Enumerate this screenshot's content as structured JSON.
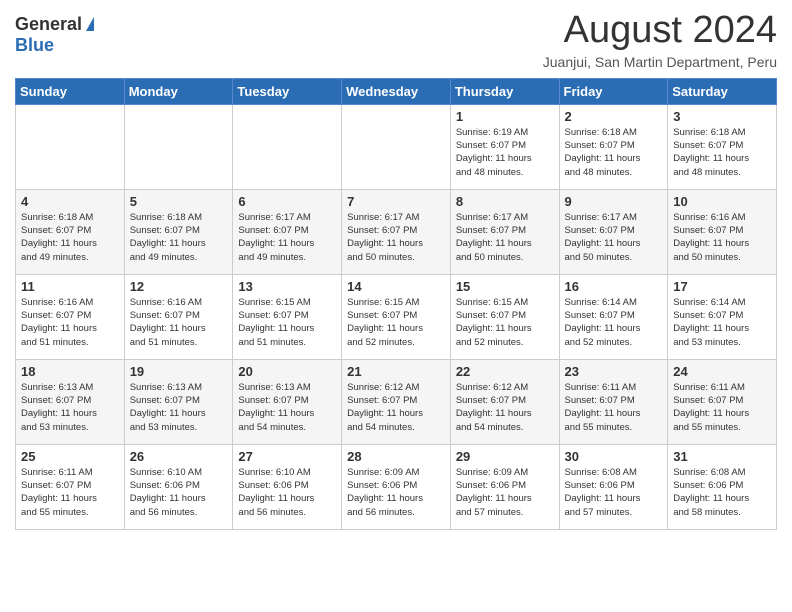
{
  "header": {
    "logo_general": "General",
    "logo_blue": "Blue",
    "month_title": "August 2024",
    "location": "Juanjui, San Martin Department, Peru"
  },
  "weekdays": [
    "Sunday",
    "Monday",
    "Tuesday",
    "Wednesday",
    "Thursday",
    "Friday",
    "Saturday"
  ],
  "weeks": [
    [
      {
        "day": "",
        "info": ""
      },
      {
        "day": "",
        "info": ""
      },
      {
        "day": "",
        "info": ""
      },
      {
        "day": "",
        "info": ""
      },
      {
        "day": "1",
        "info": "Sunrise: 6:19 AM\nSunset: 6:07 PM\nDaylight: 11 hours\nand 48 minutes."
      },
      {
        "day": "2",
        "info": "Sunrise: 6:18 AM\nSunset: 6:07 PM\nDaylight: 11 hours\nand 48 minutes."
      },
      {
        "day": "3",
        "info": "Sunrise: 6:18 AM\nSunset: 6:07 PM\nDaylight: 11 hours\nand 48 minutes."
      }
    ],
    [
      {
        "day": "4",
        "info": "Sunrise: 6:18 AM\nSunset: 6:07 PM\nDaylight: 11 hours\nand 49 minutes."
      },
      {
        "day": "5",
        "info": "Sunrise: 6:18 AM\nSunset: 6:07 PM\nDaylight: 11 hours\nand 49 minutes."
      },
      {
        "day": "6",
        "info": "Sunrise: 6:17 AM\nSunset: 6:07 PM\nDaylight: 11 hours\nand 49 minutes."
      },
      {
        "day": "7",
        "info": "Sunrise: 6:17 AM\nSunset: 6:07 PM\nDaylight: 11 hours\nand 50 minutes."
      },
      {
        "day": "8",
        "info": "Sunrise: 6:17 AM\nSunset: 6:07 PM\nDaylight: 11 hours\nand 50 minutes."
      },
      {
        "day": "9",
        "info": "Sunrise: 6:17 AM\nSunset: 6:07 PM\nDaylight: 11 hours\nand 50 minutes."
      },
      {
        "day": "10",
        "info": "Sunrise: 6:16 AM\nSunset: 6:07 PM\nDaylight: 11 hours\nand 50 minutes."
      }
    ],
    [
      {
        "day": "11",
        "info": "Sunrise: 6:16 AM\nSunset: 6:07 PM\nDaylight: 11 hours\nand 51 minutes."
      },
      {
        "day": "12",
        "info": "Sunrise: 6:16 AM\nSunset: 6:07 PM\nDaylight: 11 hours\nand 51 minutes."
      },
      {
        "day": "13",
        "info": "Sunrise: 6:15 AM\nSunset: 6:07 PM\nDaylight: 11 hours\nand 51 minutes."
      },
      {
        "day": "14",
        "info": "Sunrise: 6:15 AM\nSunset: 6:07 PM\nDaylight: 11 hours\nand 52 minutes."
      },
      {
        "day": "15",
        "info": "Sunrise: 6:15 AM\nSunset: 6:07 PM\nDaylight: 11 hours\nand 52 minutes."
      },
      {
        "day": "16",
        "info": "Sunrise: 6:14 AM\nSunset: 6:07 PM\nDaylight: 11 hours\nand 52 minutes."
      },
      {
        "day": "17",
        "info": "Sunrise: 6:14 AM\nSunset: 6:07 PM\nDaylight: 11 hours\nand 53 minutes."
      }
    ],
    [
      {
        "day": "18",
        "info": "Sunrise: 6:13 AM\nSunset: 6:07 PM\nDaylight: 11 hours\nand 53 minutes."
      },
      {
        "day": "19",
        "info": "Sunrise: 6:13 AM\nSunset: 6:07 PM\nDaylight: 11 hours\nand 53 minutes."
      },
      {
        "day": "20",
        "info": "Sunrise: 6:13 AM\nSunset: 6:07 PM\nDaylight: 11 hours\nand 54 minutes."
      },
      {
        "day": "21",
        "info": "Sunrise: 6:12 AM\nSunset: 6:07 PM\nDaylight: 11 hours\nand 54 minutes."
      },
      {
        "day": "22",
        "info": "Sunrise: 6:12 AM\nSunset: 6:07 PM\nDaylight: 11 hours\nand 54 minutes."
      },
      {
        "day": "23",
        "info": "Sunrise: 6:11 AM\nSunset: 6:07 PM\nDaylight: 11 hours\nand 55 minutes."
      },
      {
        "day": "24",
        "info": "Sunrise: 6:11 AM\nSunset: 6:07 PM\nDaylight: 11 hours\nand 55 minutes."
      }
    ],
    [
      {
        "day": "25",
        "info": "Sunrise: 6:11 AM\nSunset: 6:07 PM\nDaylight: 11 hours\nand 55 minutes."
      },
      {
        "day": "26",
        "info": "Sunrise: 6:10 AM\nSunset: 6:06 PM\nDaylight: 11 hours\nand 56 minutes."
      },
      {
        "day": "27",
        "info": "Sunrise: 6:10 AM\nSunset: 6:06 PM\nDaylight: 11 hours\nand 56 minutes."
      },
      {
        "day": "28",
        "info": "Sunrise: 6:09 AM\nSunset: 6:06 PM\nDaylight: 11 hours\nand 56 minutes."
      },
      {
        "day": "29",
        "info": "Sunrise: 6:09 AM\nSunset: 6:06 PM\nDaylight: 11 hours\nand 57 minutes."
      },
      {
        "day": "30",
        "info": "Sunrise: 6:08 AM\nSunset: 6:06 PM\nDaylight: 11 hours\nand 57 minutes."
      },
      {
        "day": "31",
        "info": "Sunrise: 6:08 AM\nSunset: 6:06 PM\nDaylight: 11 hours\nand 58 minutes."
      }
    ]
  ]
}
